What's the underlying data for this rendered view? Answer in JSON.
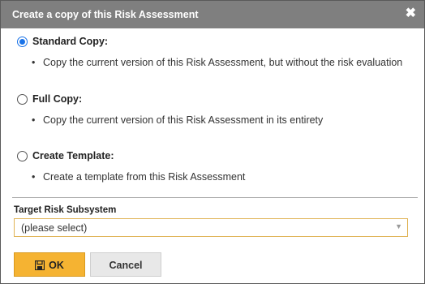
{
  "dialog": {
    "title": "Create a copy of this Risk Assessment",
    "close_glyph": "✖",
    "options": [
      {
        "label": "Standard Copy:",
        "description": "Copy the current version of this Risk Assessment, but without the risk evaluation",
        "selected": true
      },
      {
        "label": "Full Copy:",
        "description": "Copy the current version of this Risk Assessment in its entirety",
        "selected": false
      },
      {
        "label": "Create Template:",
        "description": "Create a template from this Risk Assessment",
        "selected": false
      }
    ],
    "bullet": "•",
    "target_field": {
      "label": "Target Risk Subsystem",
      "value": "(please select)",
      "caret": "▼"
    },
    "buttons": {
      "ok_label": "OK",
      "ok_icon": "save-icon",
      "cancel_label": "Cancel"
    },
    "colors": {
      "titlebar": "#7f7f7f",
      "accent": "#1a73e8",
      "ok_button": "#f5b332",
      "select_border": "#e0b355"
    }
  }
}
